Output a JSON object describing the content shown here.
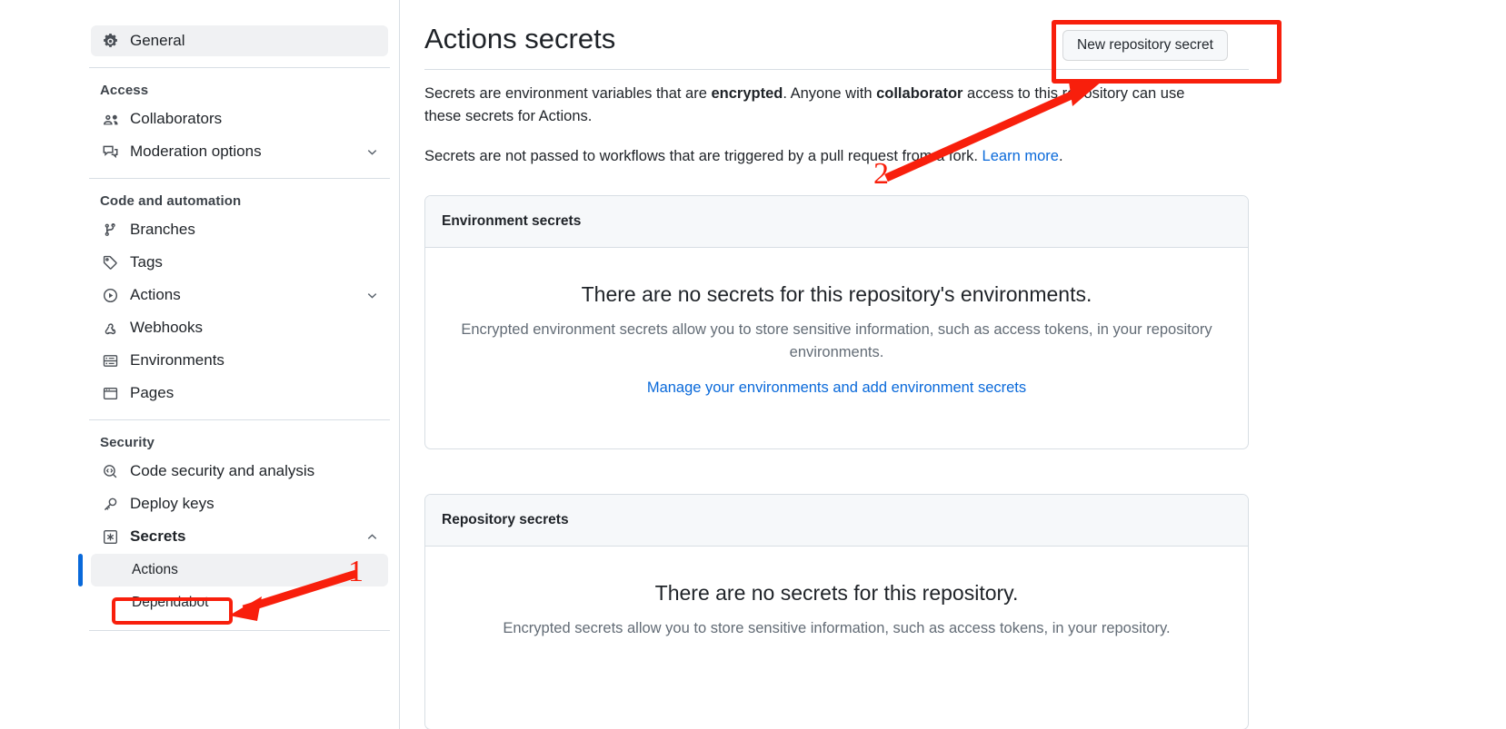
{
  "sidebar": {
    "top_item": {
      "label": "General",
      "icon": "gear-icon"
    },
    "sections": [
      {
        "title": "Access",
        "items": [
          {
            "label": "Collaborators",
            "icon": "people-icon",
            "chevron": false
          },
          {
            "label": "Moderation options",
            "icon": "comment-discussion-icon",
            "chevron": true
          }
        ]
      },
      {
        "title": "Code and automation",
        "items": [
          {
            "label": "Branches",
            "icon": "git-branch-icon",
            "chevron": false
          },
          {
            "label": "Tags",
            "icon": "tag-icon",
            "chevron": false
          },
          {
            "label": "Actions",
            "icon": "play-icon",
            "chevron": true
          },
          {
            "label": "Webhooks",
            "icon": "webhook-icon",
            "chevron": false
          },
          {
            "label": "Environments",
            "icon": "server-icon",
            "chevron": false
          },
          {
            "label": "Pages",
            "icon": "browser-icon",
            "chevron": false
          }
        ]
      },
      {
        "title": "Security",
        "items": [
          {
            "label": "Code security and analysis",
            "icon": "codescan-icon",
            "chevron": false
          },
          {
            "label": "Deploy keys",
            "icon": "key-icon",
            "chevron": false
          },
          {
            "label": "Secrets",
            "icon": "asterisk-icon",
            "chevron": true,
            "expanded": true,
            "chevron_dir": "up"
          }
        ],
        "subitems": [
          {
            "label": "Actions",
            "active": true
          },
          {
            "label": "Dependabot",
            "active": false
          }
        ]
      }
    ]
  },
  "main": {
    "title": "Actions secrets",
    "new_secret_button": "New repository secret",
    "description": {
      "p1_a": "Secrets are environment variables that are ",
      "p1_bold1": "encrypted",
      "p1_b": ". Anyone with ",
      "p1_bold2": "collaborator",
      "p1_c": " access to this repository can use these secrets for Actions.",
      "p2_a": "Secrets are not passed to workflows that are triggered by a pull request from a fork. ",
      "p2_link": "Learn more",
      "p2_b": "."
    },
    "cards": [
      {
        "header": "Environment secrets",
        "blank_title": "There are no secrets for this repository's environments.",
        "blank_desc": "Encrypted environment secrets allow you to store sensitive information, such as access tokens, in your repository environments.",
        "blank_link": "Manage your environments and add environment secrets"
      },
      {
        "header": "Repository secrets",
        "blank_title": "There are no secrets for this repository.",
        "blank_desc": "Encrypted secrets allow you to store sensitive information, such as access tokens, in your repository.",
        "blank_link": ""
      }
    ]
  },
  "annotations": {
    "color": "#f81f0c",
    "step1_label": "1",
    "step2_label": "2"
  }
}
